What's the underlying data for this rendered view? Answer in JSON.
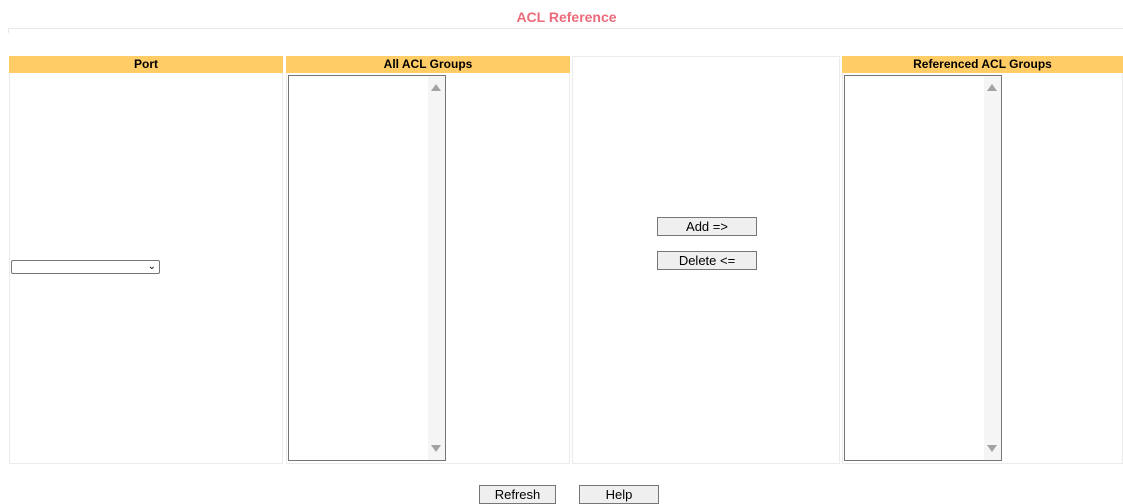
{
  "page": {
    "title": "ACL Reference"
  },
  "columns": {
    "port": "Port",
    "all_groups": "All ACL Groups",
    "referenced_groups": "Referenced ACL Groups"
  },
  "port_select": {
    "selected": ""
  },
  "all_groups_list": {
    "items": []
  },
  "referenced_groups_list": {
    "items": []
  },
  "actions": {
    "add_label": "Add =>",
    "delete_label": "Delete <="
  },
  "footer": {
    "refresh_label": "Refresh",
    "help_label": "Help"
  },
  "colors": {
    "title": "#ec6b7a",
    "header_bg": "#ffcc66"
  },
  "icons": {
    "select_chevron": "chevron-down-icon",
    "scroll_up": "scroll-up-arrow-icon",
    "scroll_down": "scroll-down-arrow-icon"
  }
}
